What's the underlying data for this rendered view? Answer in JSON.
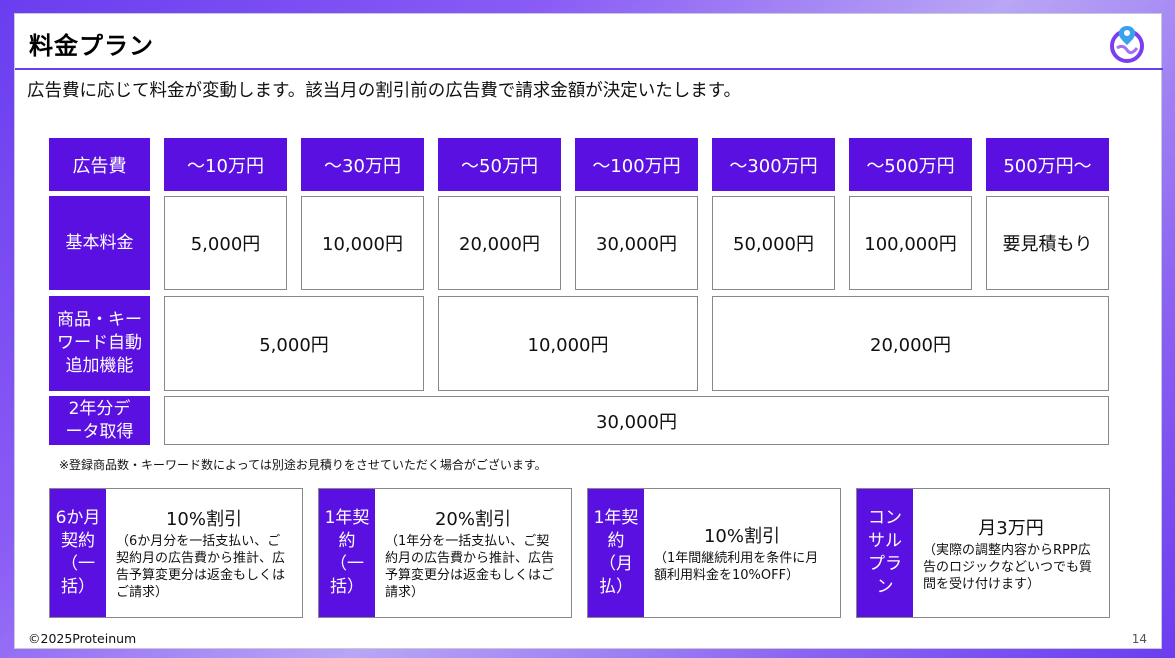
{
  "title": "料金プラン",
  "subtitle": "広告費に応じて料金が変動します。該当月の割引前の広告費で請求金額が決定いたします。",
  "table": {
    "header_label": "広告費",
    "tiers": [
      "～10万円",
      "～30万円",
      "～50万円",
      "～100万円",
      "～300万円",
      "～500万円",
      "500万円～"
    ],
    "rows": {
      "basic": {
        "label": "基本料金",
        "values": [
          "5,000円",
          "10,000円",
          "20,000円",
          "30,000円",
          "50,000円",
          "100,000円",
          "要見積もり"
        ]
      },
      "auto": {
        "label": "商品・キーワード自動追加機能",
        "values": [
          "5,000円",
          "10,000円",
          "20,000円"
        ]
      },
      "data": {
        "label": "2年分データ取得",
        "value": "30,000円"
      }
    }
  },
  "note": "※登録商品数・キーワード数によっては別途お見積りをさせていただく場合がございます。",
  "discounts": [
    {
      "label": "6か月契約（一括）",
      "main": "10%割引",
      "desc": "（6か月分を一括支払い、ご契約月の広告費から推計、広告予算変更分は返金もしくはご請求）"
    },
    {
      "label": "1年契約（一括）",
      "main": "20%割引",
      "desc": "（1年分を一括支払い、ご契約月の広告費から推計、広告予算変更分は返金もしくはご請求）"
    },
    {
      "label": "1年契約（月払）",
      "main": "10%割引",
      "desc": "（1年間継続利用を条件に月額利用料金を10%OFF）"
    },
    {
      "label": "コンサルプラン",
      "main": "月3万円",
      "desc": "（実際の調整内容からRPP広告のロジックなどいつでも質問を受け付けます）"
    }
  ],
  "copyright": "©2025Proteinum",
  "page_number": "14",
  "colors": {
    "accent": "#5a10e0"
  },
  "logo_icon": "map-pin-logo-icon"
}
